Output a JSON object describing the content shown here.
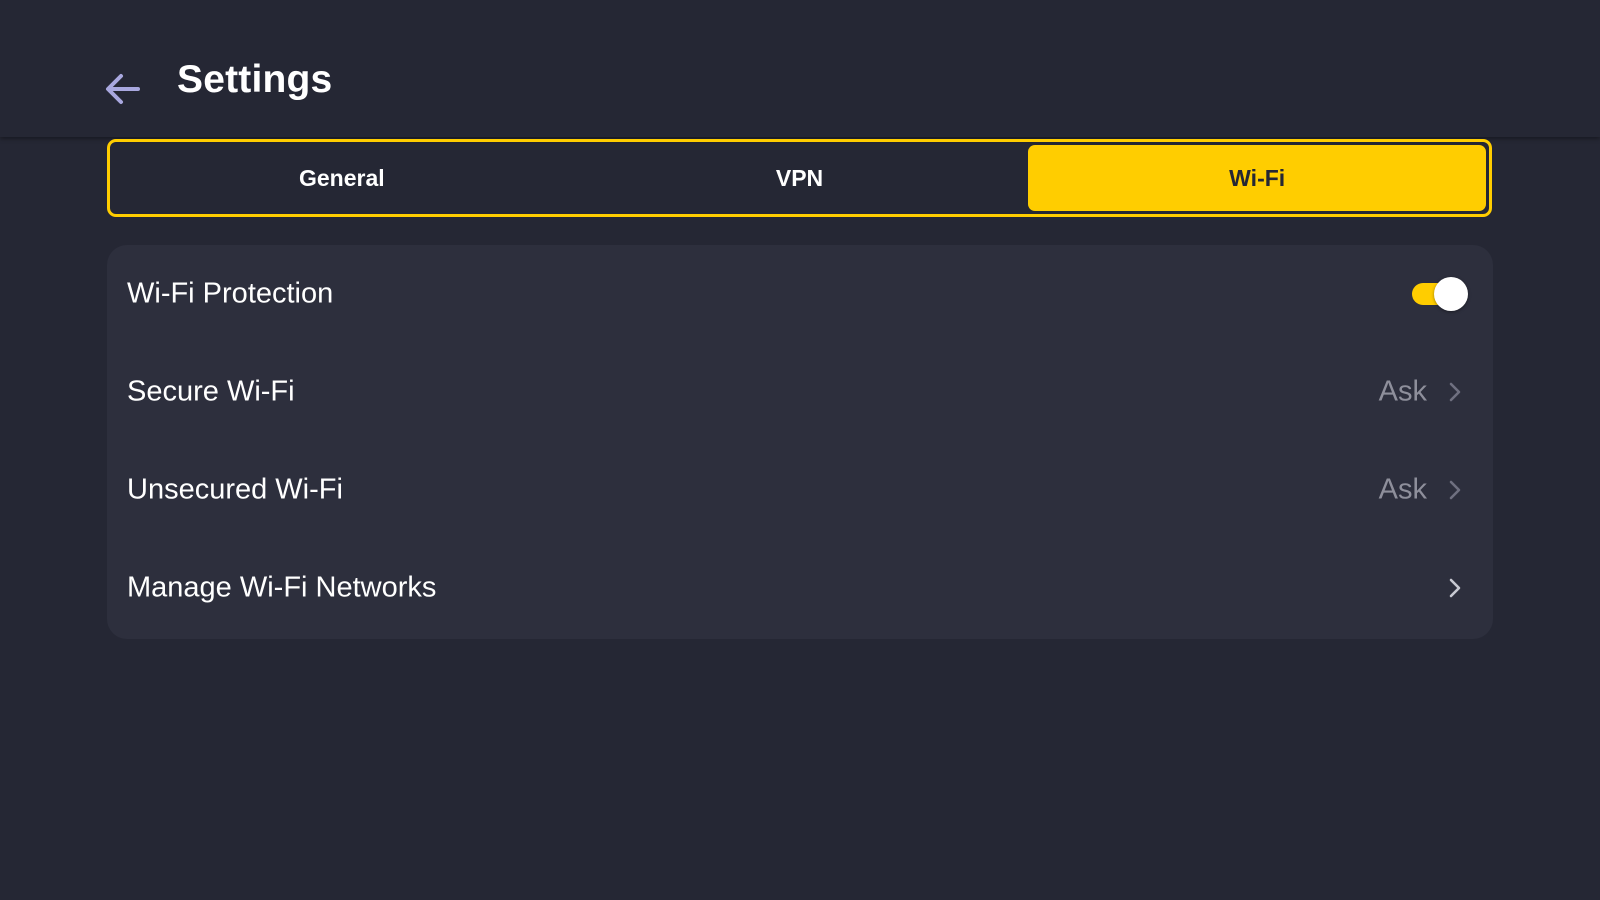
{
  "header": {
    "title": "Settings",
    "back_icon": "arrow-left-icon"
  },
  "tabs": [
    {
      "label": "General",
      "active": false
    },
    {
      "label": "VPN",
      "active": false
    },
    {
      "label": "Wi-Fi",
      "active": true
    }
  ],
  "settings": {
    "wifi_protection": {
      "label": "Wi-Fi Protection",
      "enabled": true
    },
    "secure_wifi": {
      "label": "Secure Wi-Fi",
      "value": "Ask"
    },
    "unsecured_wifi": {
      "label": "Unsecured Wi-Fi",
      "value": "Ask"
    },
    "manage_networks": {
      "label": "Manage Wi-Fi Networks"
    }
  },
  "colors": {
    "background": "#252734",
    "accent": "#ffcd00",
    "panel": "#2d2f3d",
    "muted_text": "#8e8f9b",
    "back_icon": "#a9a8df"
  }
}
